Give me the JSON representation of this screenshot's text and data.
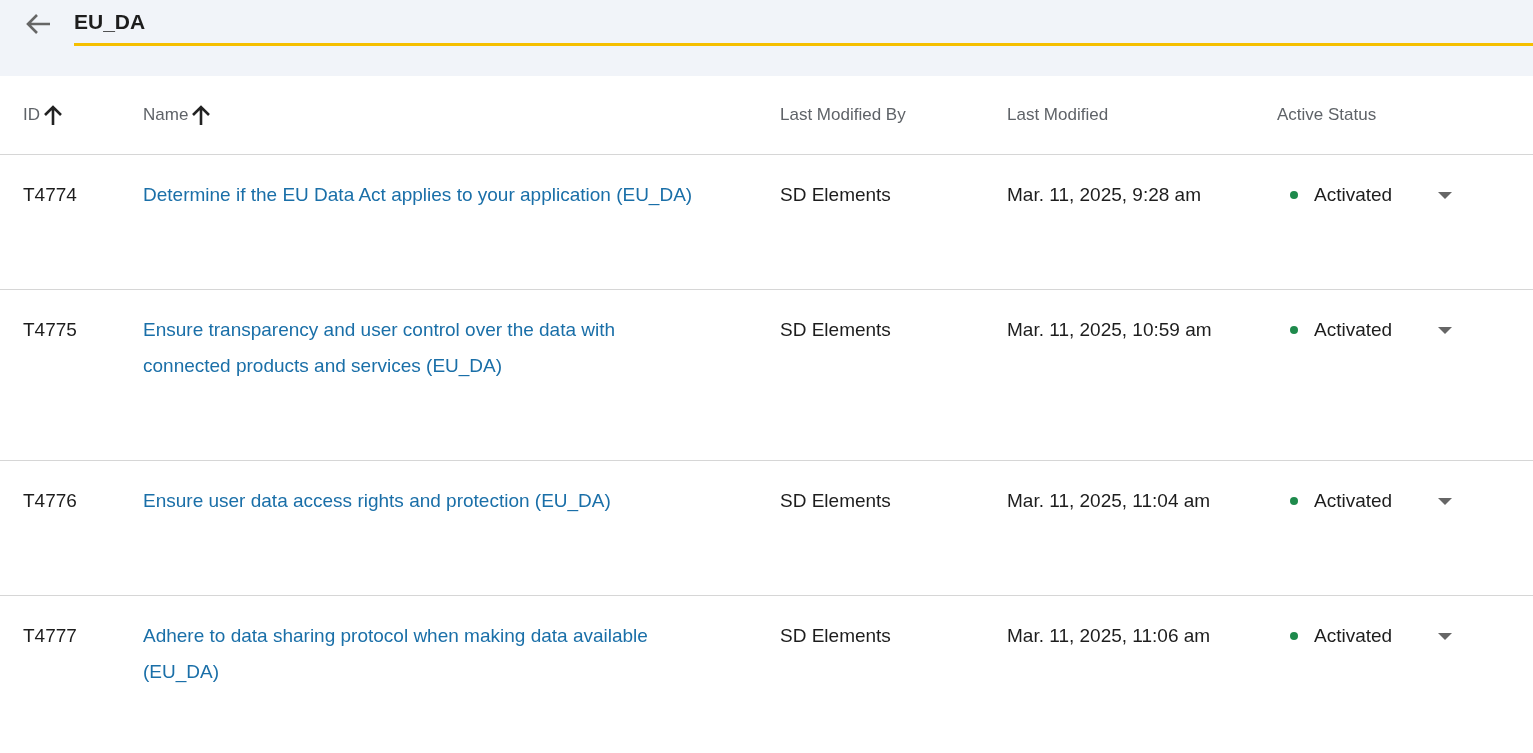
{
  "search": {
    "value": "EU_DA"
  },
  "table": {
    "columns": [
      {
        "label": "ID",
        "sorted": true
      },
      {
        "label": "Name",
        "sorted": true
      },
      {
        "label": "Last Modified By",
        "sorted": false
      },
      {
        "label": "Last Modified",
        "sorted": false
      },
      {
        "label": "Active Status",
        "sorted": false
      }
    ],
    "rows": [
      {
        "id": "T4774",
        "name": "Determine if the EU Data Act applies to your application (EU_DA)",
        "modified_by": "SD Elements",
        "modified": "Mar. 11, 2025, 9:28 am",
        "status": "Activated",
        "color": "#1e8a4c"
      },
      {
        "id": "T4775",
        "name": "Ensure transparency and user control over the data with connected products and services (EU_DA)",
        "modified_by": "SD Elements",
        "modified": "Mar. 11, 2025, 10:59 am",
        "status": "Activated",
        "color": "#1e8a4c"
      },
      {
        "id": "T4776",
        "name": "Ensure user data access rights and protection (EU_DA)",
        "modified_by": "SD Elements",
        "modified": "Mar. 11, 2025, 11:04 am",
        "status": "Activated",
        "color": "#1e8a4c"
      },
      {
        "id": "T4777",
        "name": "Adhere to data sharing protocol when making data available (EU_DA)",
        "modified_by": "SD Elements",
        "modified": "Mar. 11, 2025, 11:06 am",
        "status": "Activated",
        "color": "#1e8a4c"
      }
    ]
  }
}
